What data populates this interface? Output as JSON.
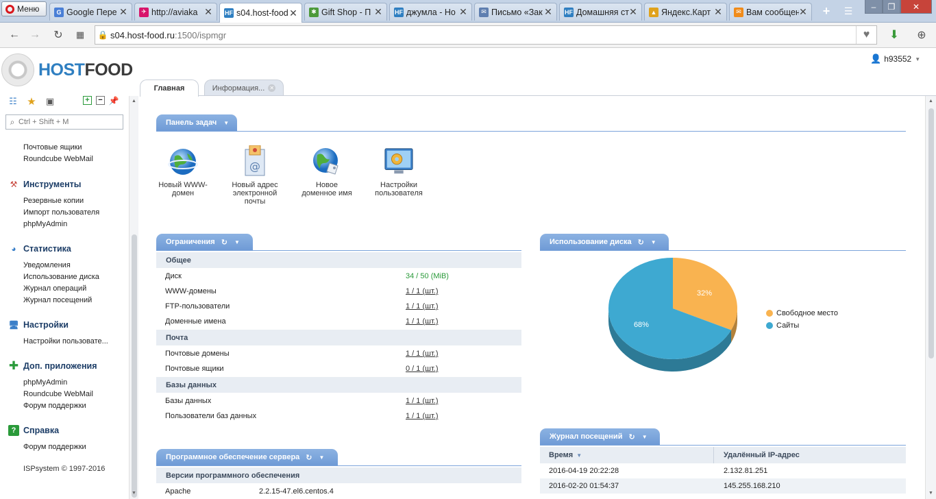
{
  "browser": {
    "menu_label": "Меню",
    "tabs": [
      {
        "title": "Google Пере",
        "fav_color": "#4a7fd6",
        "fav": "G"
      },
      {
        "title": "http://aviaka",
        "fav_color": "#d8156b",
        "fav": "✈"
      },
      {
        "title": "s04.host-food",
        "fav_color": "#2f7fc1",
        "fav": "HF",
        "active": true
      },
      {
        "title": "Gift Shop - П",
        "fav_color": "#4d9a3a",
        "fav": "✱"
      },
      {
        "title": "джумла - Но",
        "fav_color": "#2f7fc1",
        "fav": "HF"
      },
      {
        "title": "Письмо «Зак",
        "fav_color": "#5f7fb0",
        "fav": "✉"
      },
      {
        "title": "Домашняя ст",
        "fav_color": "#2f7fc1",
        "fav": "HF"
      },
      {
        "title": "Яндекс.Карт",
        "fav_color": "#e0a21c",
        "fav": "▲"
      },
      {
        "title": "Вам сообщен",
        "fav_color": "#f08b1a",
        "fav": "✉"
      }
    ],
    "url_host": "s04.host-food.ru",
    "url_rest": ":1500/ispmgr"
  },
  "header": {
    "logo_part1": "HOST",
    "logo_part2": "FOOD",
    "username": "h93552"
  },
  "main_tabs": [
    {
      "label": "Главная"
    },
    {
      "label": "Информация..."
    }
  ],
  "sidebar": {
    "search_placeholder": "Ctrl + Shift + M",
    "top_links": [
      "Почтовые ящики",
      "Roundcube WebMail"
    ],
    "sections": [
      {
        "title": "Инструменты",
        "links": [
          "Резервные копии",
          "Импорт пользователя",
          "phpMyAdmin"
        ]
      },
      {
        "title": "Статистика",
        "links": [
          "Уведомления",
          "Использование диска",
          "Журнал операций",
          "Журнал посещений"
        ]
      },
      {
        "title": "Настройки",
        "links": [
          "Настройки пользовате..."
        ]
      },
      {
        "title": "Доп. приложения",
        "links": [
          "phpMyAdmin",
          "Roundcube WebMail",
          "Форум поддержки"
        ]
      },
      {
        "title": "Справка",
        "links": [
          "Форум поддержки"
        ]
      }
    ],
    "copyright": "ISPsystem © 1997-2016"
  },
  "taskbar": {
    "title": "Панель задач",
    "items": [
      {
        "label": "Новый WWW-домен"
      },
      {
        "label": "Новый адрес электронной почты"
      },
      {
        "label": "Новое доменное имя"
      },
      {
        "label": "Настройки пользователя"
      }
    ]
  },
  "limits": {
    "title": "Ограничения",
    "groups": [
      {
        "name": "Общее",
        "rows": [
          {
            "label": "Диск",
            "value": "34 / 50 (MiB)"
          },
          {
            "label": "WWW-домены",
            "value": "1 / 1 (шт.)"
          },
          {
            "label": "FTP-пользователи",
            "value": "1 / 1 (шт.)"
          },
          {
            "label": "Доменные имена",
            "value": "1 / 1 (шт.)"
          }
        ]
      },
      {
        "name": "Почта",
        "rows": [
          {
            "label": "Почтовые домены",
            "value": "1 / 1 (шт.)"
          },
          {
            "label": "Почтовые ящики",
            "value": "0 / 1 (шт.)"
          }
        ]
      },
      {
        "name": "Базы данных",
        "rows": [
          {
            "label": "Базы данных",
            "value": "1 / 1 (шт.)"
          },
          {
            "label": "Пользователи баз данных",
            "value": "1 / 1 (шт.)"
          }
        ]
      }
    ]
  },
  "software": {
    "title": "Программное обеспечение сервера",
    "group": "Версии программного обеспечения",
    "rows": [
      {
        "name": "Apache",
        "version": "2.2.15-47.el6.centos.4"
      }
    ]
  },
  "disk": {
    "title": "Использование диска",
    "legend": [
      {
        "label": "Свободное место",
        "color": "#f9b350"
      },
      {
        "label": "Сайты",
        "color": "#3ea9d1"
      }
    ]
  },
  "chart_data": {
    "type": "pie",
    "categories": [
      "Свободное место",
      "Сайты"
    ],
    "values": [
      32,
      68
    ],
    "labels": [
      "32%",
      "68%"
    ],
    "colors": [
      "#f9b350",
      "#3ea9d1"
    ],
    "title": "Использование диска",
    "legend": "right"
  },
  "visits": {
    "title": "Журнал посещений",
    "columns": [
      "Время",
      "Удалённый IP-адрес"
    ],
    "rows": [
      {
        "time": "2016-04-19 20:22:28",
        "ip": "2.132.81.251"
      },
      {
        "time": "2016-02-20 01:54:37",
        "ip": "145.255.168.210"
      }
    ]
  }
}
